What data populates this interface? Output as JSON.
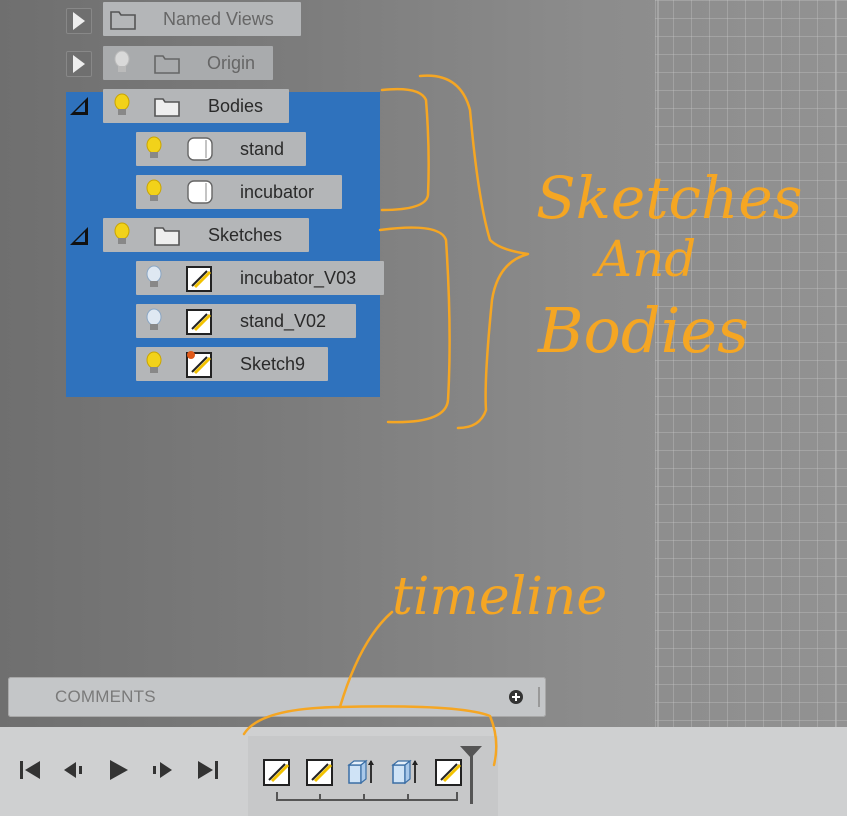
{
  "browser": {
    "items": [
      {
        "label": "Named Views",
        "expand": "collapsed",
        "visible": null,
        "dim": false
      },
      {
        "label": "Origin",
        "expand": "collapsed",
        "visible": false,
        "dim": true
      },
      {
        "label": "Bodies",
        "expand": "expanded",
        "visible": true,
        "dim": false
      },
      {
        "label": "stand",
        "type": "body",
        "visible": true
      },
      {
        "label": "incubator",
        "type": "body",
        "visible": true
      },
      {
        "label": "Sketches",
        "expand": "expanded",
        "visible": true,
        "dim": false
      },
      {
        "label": "incubator_V03",
        "type": "sketch",
        "visible": false
      },
      {
        "label": "stand_V02",
        "type": "sketch",
        "visible": false
      },
      {
        "label": "Sketch9",
        "type": "sketch-new",
        "visible": true
      }
    ]
  },
  "comments": {
    "label": "COMMENTS",
    "add_icon": "plus-circle-icon"
  },
  "playback": {
    "buttons": [
      "skip-to-start-icon",
      "step-back-icon",
      "play-icon",
      "step-forward-icon",
      "skip-to-end-icon"
    ]
  },
  "timeline": {
    "features": [
      "sketch-icon",
      "sketch-icon",
      "extrude-icon",
      "extrude-icon",
      "sketch-icon"
    ]
  },
  "annotations": {
    "bracket_text_1": "Sketches",
    "bracket_text_2": "And",
    "bracket_text_3": "Bodies",
    "timeline_text": "timeline"
  },
  "colors": {
    "selection": "#2f72bd",
    "annotation": "#f5a623",
    "bulb": "#f2d21a"
  }
}
